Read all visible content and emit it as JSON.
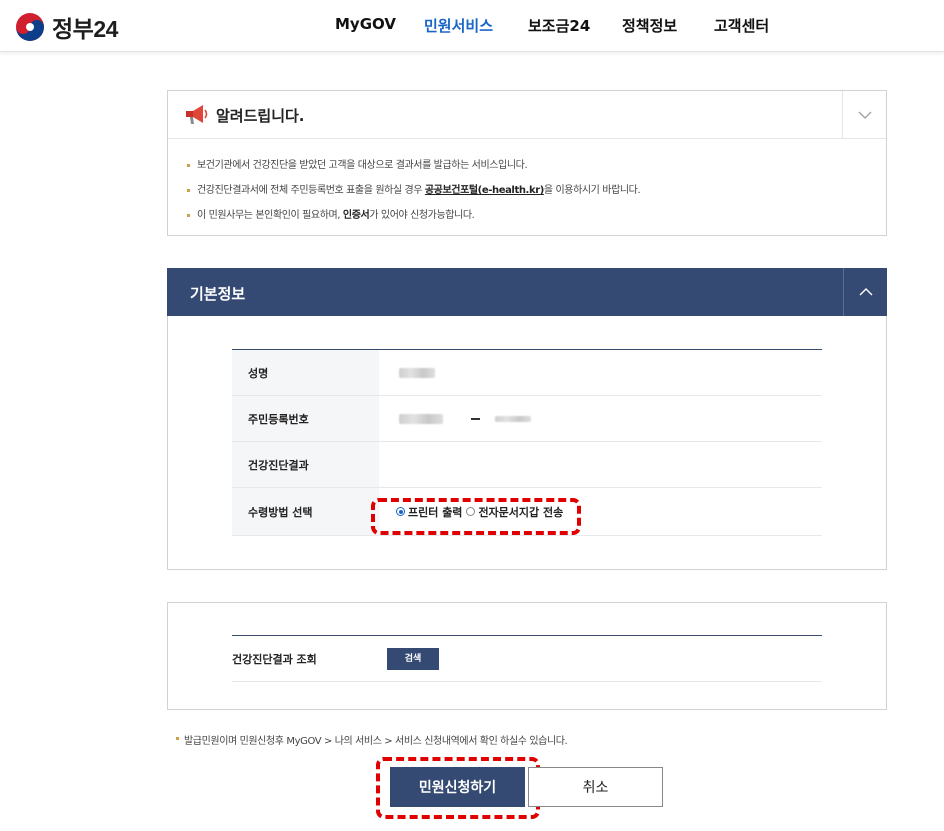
{
  "header": {
    "logo_text": "정부24",
    "nav": [
      "MyGOV",
      "민원서비스",
      "보조금24",
      "정책정보",
      "고객센터"
    ],
    "active_nav": "민원서비스"
  },
  "notice": {
    "title": "알려드립니다.",
    "items": [
      {
        "text": "보건기관에서 건강진단을 받았던 고객을 대상으로 결과서를 발급하는 서비스입니다."
      },
      {
        "pre": "건강진단결과서에 전체 주민등록번호 표출을 원하실 경우 ",
        "link": "공공보건포털(e-health.kr)",
        "post": "을 이용하시기 바랍니다."
      },
      {
        "pre": "이 민원사무는 본인확인이 필요하며, ",
        "bold": "인증서",
        "post": "가 있어야 신청가능합니다."
      }
    ]
  },
  "basic_info": {
    "title": "기본정보",
    "rows": {
      "name_label": "성명",
      "rrn_label": "주민등록번호",
      "result_label": "건강진단결과",
      "receive_label": "수령방법 선택"
    },
    "receive_options": [
      "프린터 출력",
      "전자문서지갑 전송"
    ],
    "receive_selected": "프린터 출력"
  },
  "lookup": {
    "label": "건강진단결과 조회",
    "button": "검색"
  },
  "footnote": "발급민원이며 민원신청후 MyGOV > 나의 서비스 > 서비스 신청내역에서 확인 하실수 있습니다.",
  "actions": {
    "apply": "민원신청하기",
    "cancel": "취소"
  },
  "colors": {
    "primary": "#344a73",
    "active_nav": "#1a66c8",
    "highlight": "#e00000"
  }
}
